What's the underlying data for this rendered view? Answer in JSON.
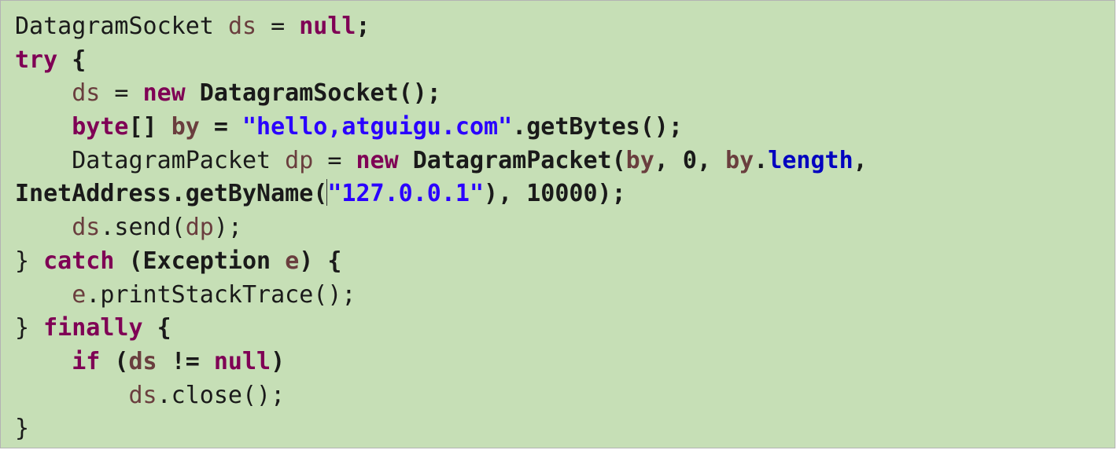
{
  "code_lines": [
    [
      {
        "t": "DatagramSocket ",
        "c": "n"
      },
      {
        "t": "ds",
        "c": "var"
      },
      {
        "t": " = ",
        "c": "n"
      },
      {
        "t": "null",
        "c": "kw"
      },
      {
        "t": ";",
        "c": "b"
      }
    ],
    [
      {
        "t": "try",
        "c": "kw"
      },
      {
        "t": " {",
        "c": "b"
      }
    ],
    [
      {
        "t": "    ",
        "c": "n"
      },
      {
        "t": "ds",
        "c": "var"
      },
      {
        "t": " = ",
        "c": "n"
      },
      {
        "t": "new",
        "c": "kw"
      },
      {
        "t": " DatagramSocket();",
        "c": "b"
      }
    ],
    [
      {
        "t": "    ",
        "c": "n"
      },
      {
        "t": "byte",
        "c": "kw"
      },
      {
        "t": "[] ",
        "c": "b"
      },
      {
        "t": "by",
        "c": "var b"
      },
      {
        "t": " = ",
        "c": "b"
      },
      {
        "t": "\"hello,atguigu.com\"",
        "c": "str"
      },
      {
        "t": ".getBytes();",
        "c": "b"
      }
    ],
    [
      {
        "t": "    DatagramPacket ",
        "c": "n"
      },
      {
        "t": "dp",
        "c": "var"
      },
      {
        "t": " = ",
        "c": "n"
      },
      {
        "t": "new",
        "c": "kw"
      },
      {
        "t": " DatagramPacket(",
        "c": "b"
      },
      {
        "t": "by",
        "c": "var b"
      },
      {
        "t": ", 0, ",
        "c": "b"
      },
      {
        "t": "by",
        "c": "var b"
      },
      {
        "t": ".",
        "c": "b"
      },
      {
        "t": "length",
        "c": "fld"
      },
      {
        "t": ",",
        "c": "b"
      }
    ],
    [
      {
        "t": "InetAddress.getByName(",
        "c": "b"
      },
      {
        "t": "",
        "c": "caret"
      },
      {
        "t": "\"127.0.0.1\"",
        "c": "str"
      },
      {
        "t": "), 10000);",
        "c": "b"
      }
    ],
    [
      {
        "t": "    ",
        "c": "n"
      },
      {
        "t": "ds",
        "c": "var"
      },
      {
        "t": ".send(",
        "c": "n"
      },
      {
        "t": "dp",
        "c": "var"
      },
      {
        "t": ");",
        "c": "n"
      }
    ],
    [
      {
        "t": "} ",
        "c": "n"
      },
      {
        "t": "catch",
        "c": "kw"
      },
      {
        "t": " (Exception ",
        "c": "b"
      },
      {
        "t": "e",
        "c": "var b"
      },
      {
        "t": ") {",
        "c": "b"
      }
    ],
    [
      {
        "t": "    ",
        "c": "n"
      },
      {
        "t": "e",
        "c": "var"
      },
      {
        "t": ".printStackTrace();",
        "c": "n"
      }
    ],
    [
      {
        "t": "} ",
        "c": "n"
      },
      {
        "t": "finally",
        "c": "kw"
      },
      {
        "t": " {",
        "c": "b"
      }
    ],
    [
      {
        "t": "    ",
        "c": "n"
      },
      {
        "t": "if",
        "c": "kw"
      },
      {
        "t": " (",
        "c": "b"
      },
      {
        "t": "ds",
        "c": "var b"
      },
      {
        "t": " != ",
        "c": "b"
      },
      {
        "t": "null",
        "c": "kw"
      },
      {
        "t": ")",
        "c": "b"
      }
    ],
    [
      {
        "t": "        ",
        "c": "n"
      },
      {
        "t": "ds",
        "c": "var"
      },
      {
        "t": ".close();",
        "c": "n"
      }
    ],
    [
      {
        "t": "}",
        "c": "n"
      }
    ]
  ]
}
